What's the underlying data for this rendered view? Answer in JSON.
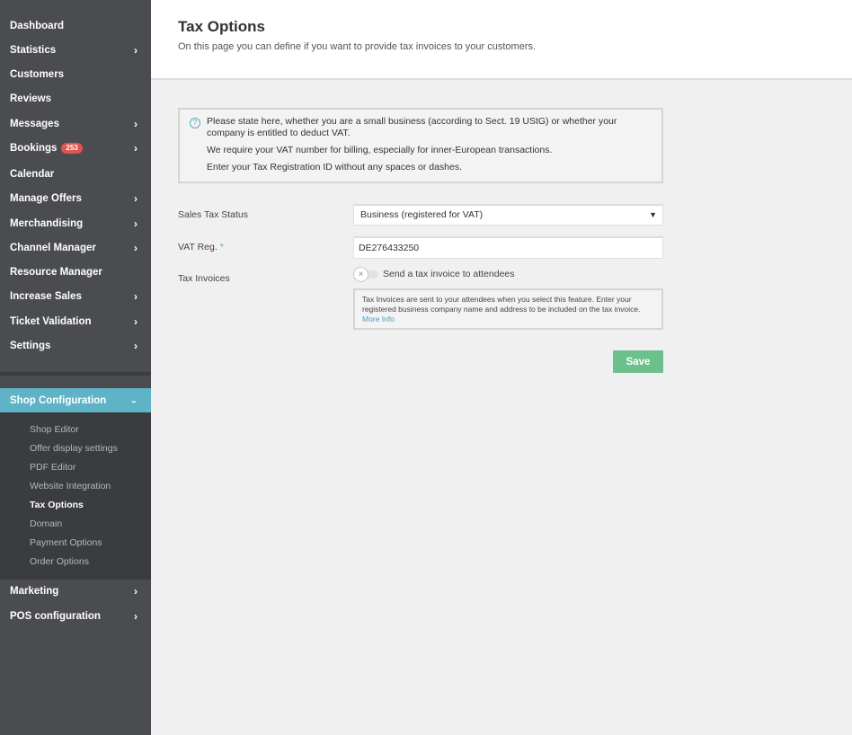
{
  "sidebar": {
    "items": [
      {
        "label": "Dashboard",
        "chevron": false
      },
      {
        "label": "Statistics",
        "chevron": true
      },
      {
        "label": "Customers",
        "chevron": false
      },
      {
        "label": "Reviews",
        "chevron": false
      },
      {
        "label": "Messages",
        "chevron": true
      },
      {
        "label": "Bookings",
        "chevron": true,
        "badge": "253"
      },
      {
        "label": "Calendar",
        "chevron": false
      },
      {
        "label": "Manage Offers",
        "chevron": true
      },
      {
        "label": "Merchandising",
        "chevron": true
      },
      {
        "label": "Channel Manager",
        "chevron": true
      },
      {
        "label": "Resource Manager",
        "chevron": false
      },
      {
        "label": "Increase Sales",
        "chevron": true
      },
      {
        "label": "Ticket Validation",
        "chevron": true
      },
      {
        "label": "Settings",
        "chevron": true
      }
    ],
    "active_section": {
      "label": "Shop Configuration",
      "chevron": "⌄"
    },
    "sub_items": [
      {
        "label": "Shop Editor"
      },
      {
        "label": "Offer display settings"
      },
      {
        "label": "PDF Editor"
      },
      {
        "label": "Website Integration"
      },
      {
        "label": "Tax Options",
        "current": true
      },
      {
        "label": "Domain"
      },
      {
        "label": "Payment Options"
      },
      {
        "label": "Order Options"
      }
    ],
    "bottom_items": [
      {
        "label": "Marketing",
        "chevron": true
      },
      {
        "label": "POS configuration",
        "chevron": true
      }
    ],
    "chevron_glyph": "›"
  },
  "header": {
    "title": "Tax Options",
    "description": "On this page you can define if you want to provide tax invoices to your customers."
  },
  "info": {
    "icon": "?",
    "line1": "Please state here, whether you are a small business (according to Sect. 19 UStG) or whether your company is entitled to deduct VAT.",
    "line2": "We require your VAT number for billing, especially for inner-European transactions.",
    "line3": "Enter your Tax Registration ID without any spaces or dashes."
  },
  "form": {
    "sales_tax_label": "Sales Tax Status",
    "sales_tax_value": "Business (registered for VAT)",
    "select_arrow": "▼",
    "vat_label": "VAT Reg.",
    "vat_required": "*",
    "vat_value": "DE276433250",
    "tax_invoices_label": "Tax Invoices",
    "toggle_label": "Send a tax invoice to attendees",
    "toggle_knob": "×",
    "toggle_on": false,
    "hint_text": "Tax Invoices are sent to your attendees when you select this feature. Enter your registered business company name and address to be included on the tax invoice.",
    "hint_link": "More Info",
    "save_label": "Save"
  },
  "colors": {
    "sidebar_bg": "#4a4c50",
    "active_bg": "#5fb3c7",
    "save_green": "#6cc08b",
    "badge_red": "#e0564f",
    "link_blue": "#4a9fc4"
  }
}
